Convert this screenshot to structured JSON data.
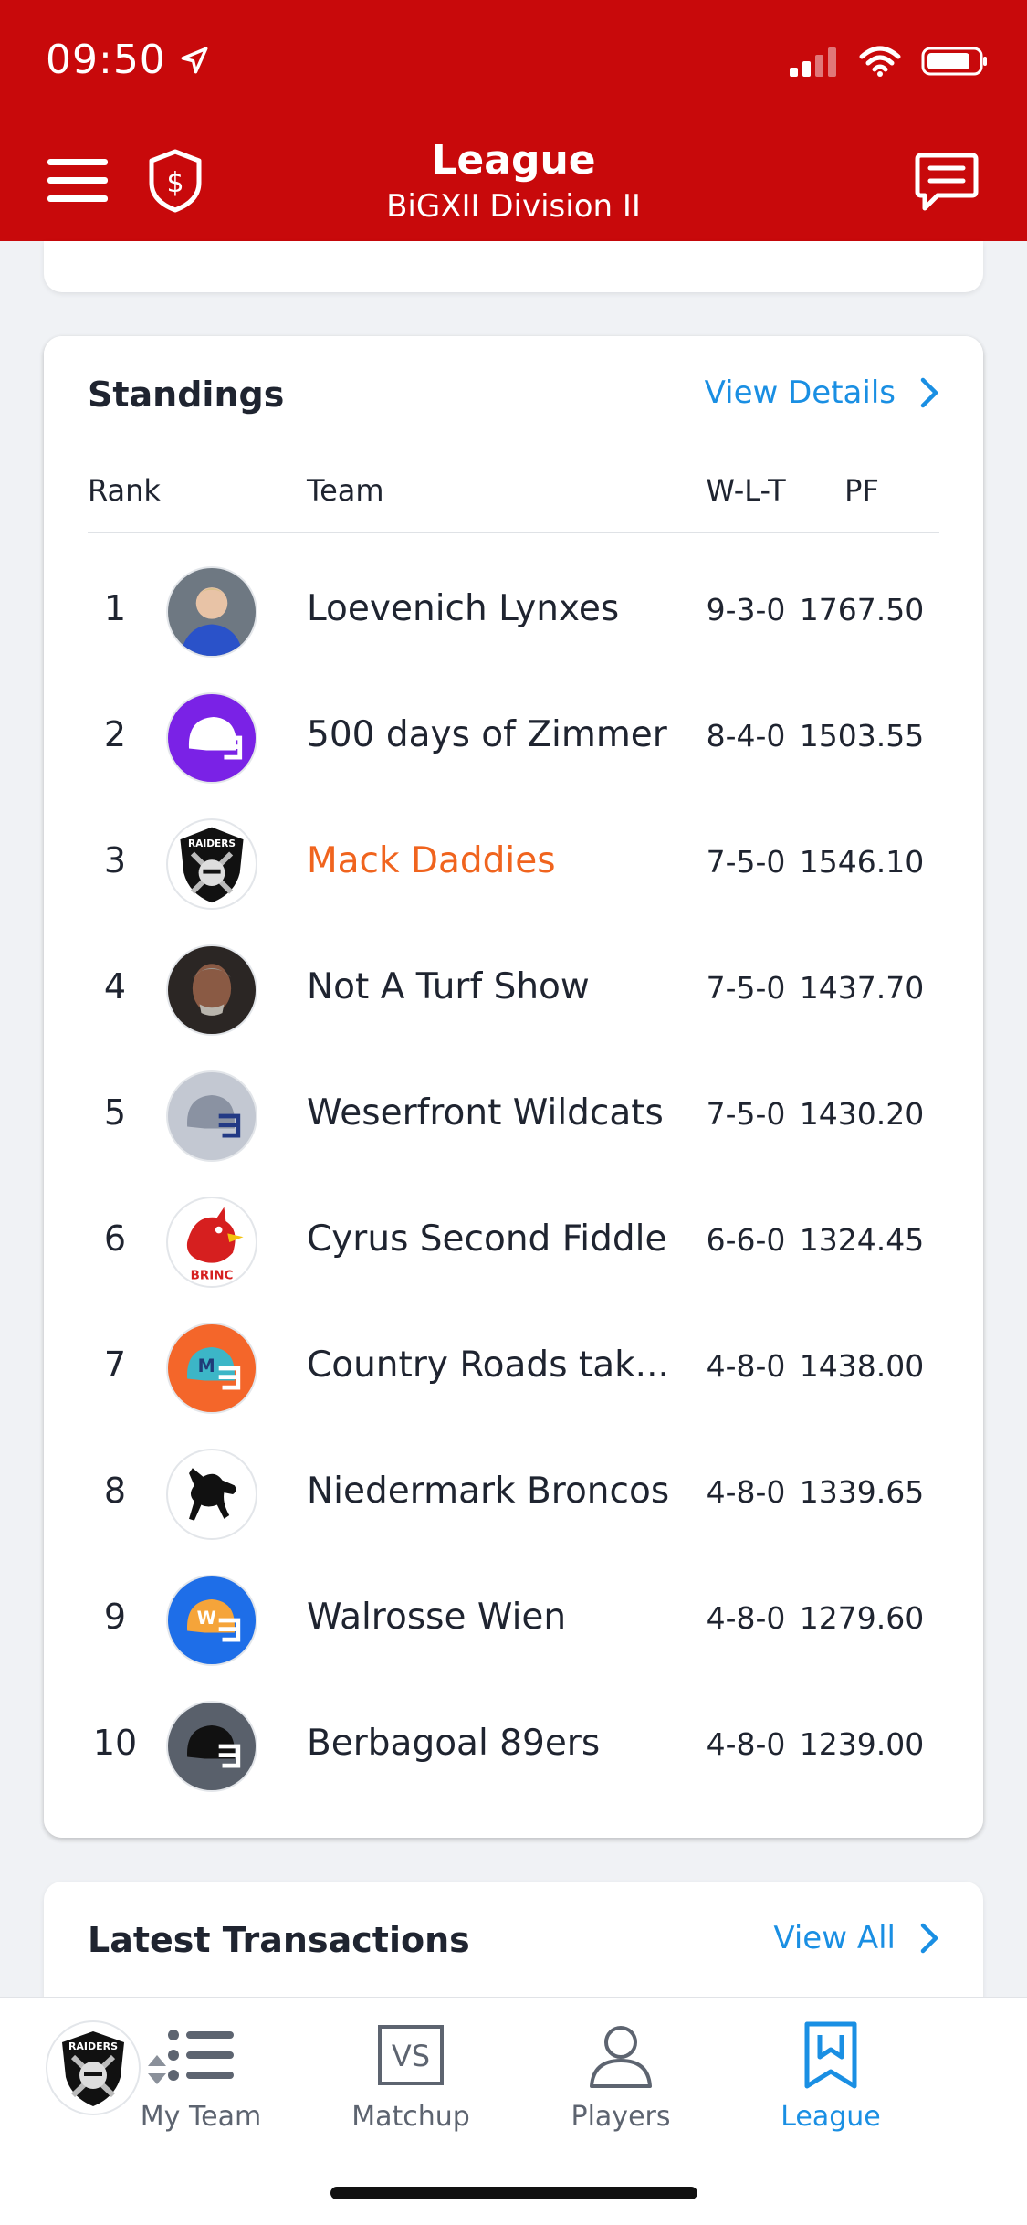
{
  "status": {
    "time": "09:50"
  },
  "header": {
    "title": "League",
    "subtitle": "BiGXII Division II"
  },
  "standings": {
    "title": "Standings",
    "link": "View Details",
    "columns": {
      "rank": "Rank",
      "team": "Team",
      "wlt": "W-L-T",
      "pf": "PF"
    },
    "rows": [
      {
        "rank": "1",
        "team": "Loevenich Lynxes",
        "wlt": "9-3-0",
        "pf": "1767.50",
        "avatar": "photo-person-icon"
      },
      {
        "rank": "2",
        "team": "500 days of Zimmer",
        "wlt": "8-4-0",
        "pf": "1503.55",
        "avatar": "helmet-purple-icon"
      },
      {
        "rank": "3",
        "team": "Mack Daddies",
        "wlt": "7-5-0",
        "pf": "1546.10",
        "avatar": "raiders-logo-icon",
        "is_user": true
      },
      {
        "rank": "4",
        "team": "Not A Turf Show",
        "wlt": "7-5-0",
        "pf": "1437.70",
        "avatar": "photo-face-icon"
      },
      {
        "rank": "5",
        "team": "Weserfront Wildcats",
        "wlt": "7-5-0",
        "pf": "1430.20",
        "avatar": "helmet-gray-icon"
      },
      {
        "rank": "6",
        "team": "Cyrus Second Fiddle",
        "wlt": "6-6-0",
        "pf": "1324.45",
        "avatar": "cardinal-logo-icon"
      },
      {
        "rank": "7",
        "team": "Country Roads tak...",
        "wlt": "4-8-0",
        "pf": "1438.00",
        "avatar": "helmet-orange-m-icon"
      },
      {
        "rank": "8",
        "team": "Niedermark Broncos",
        "wlt": "4-8-0",
        "pf": "1339.65",
        "avatar": "horse-logo-icon"
      },
      {
        "rank": "9",
        "team": "Walrosse Wien",
        "wlt": "4-8-0",
        "pf": "1279.60",
        "avatar": "helmet-blue-w-icon"
      },
      {
        "rank": "10",
        "team": "Berbagoal 89ers",
        "wlt": "4-8-0",
        "pf": "1239.00",
        "avatar": "helmet-dark-icon"
      }
    ]
  },
  "transactions": {
    "title": "Latest Transactions",
    "link": "View All"
  },
  "tabs": [
    {
      "label": "My Team",
      "icon": "list-icon"
    },
    {
      "label": "Matchup",
      "icon": "vs-icon"
    },
    {
      "label": "Players",
      "icon": "person-icon"
    },
    {
      "label": "League",
      "icon": "league-bookmark-icon",
      "active": true
    }
  ],
  "colors": {
    "brand_red": "#c8090b",
    "link_blue": "#1a8fe3",
    "user_orange": "#f0641e"
  }
}
